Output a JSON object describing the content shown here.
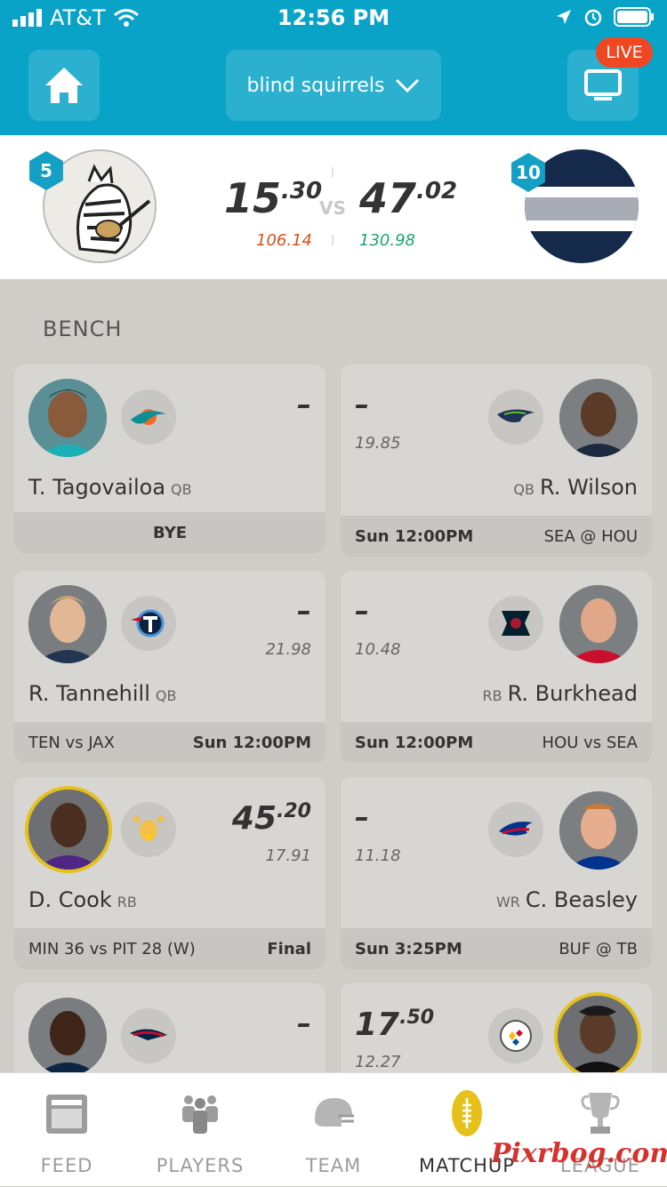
{
  "status": {
    "carrier": "AT&T",
    "time": "12:56 PM"
  },
  "header": {
    "league_name": "blind squirrels",
    "live_label": "LIVE"
  },
  "matchup": {
    "left": {
      "rank": "5",
      "score_whole": "15",
      "score_frac": ".30",
      "projected": "106.14"
    },
    "vs": "VS",
    "right": {
      "rank": "10",
      "score_whole": "47",
      "score_frac": ".02",
      "projected": "130.98"
    }
  },
  "bench": {
    "title": "BENCH",
    "cards": [
      {
        "name": "T. Tagovailoa",
        "pos": "QB",
        "points": "–",
        "proj": "",
        "foot_left": "BYE",
        "foot_right": ""
      },
      {
        "name": "R. Wilson",
        "pos": "QB",
        "points": "–",
        "proj": "19.85",
        "foot_left": "Sun 12:00PM",
        "foot_right": "SEA @ HOU"
      },
      {
        "name": "R. Tannehill",
        "pos": "QB",
        "points": "–",
        "proj": "21.98",
        "foot_left": "TEN vs JAX",
        "foot_right": "Sun 12:00PM"
      },
      {
        "name": "R. Burkhead",
        "pos": "RB",
        "points": "–",
        "proj": "10.48",
        "foot_left": "Sun 12:00PM",
        "foot_right": "HOU vs SEA"
      },
      {
        "name": "D. Cook",
        "pos": "RB",
        "points_whole": "45",
        "points_frac": ".20",
        "proj": "17.91",
        "foot_left": "MIN 36 vs PIT 28 (W)",
        "foot_right": "Final"
      },
      {
        "name": "C. Beasley",
        "pos": "WR",
        "points": "–",
        "proj": "11.18",
        "foot_left": "Sun 3:25PM",
        "foot_right": "BUF @ TB"
      },
      {
        "points": "–"
      },
      {
        "points_whole": "17",
        "points_frac": ".50",
        "proj": "12.27"
      }
    ]
  },
  "tabs": [
    {
      "label": "FEED"
    },
    {
      "label": "PLAYERS"
    },
    {
      "label": "TEAM"
    },
    {
      "label": "MATCHUP"
    },
    {
      "label": "LEAGUE"
    }
  ],
  "watermark": "Pixrbog.com",
  "colors": {
    "header": "#0aa3c8",
    "live": "#ef4722",
    "proj_bad": "#d6501b",
    "proj_good": "#1aa76b",
    "active_tab": "#e5c11a"
  },
  "icons": [
    "home-icon",
    "chevron-down-icon",
    "tv-icon",
    "signal-icon",
    "wifi-icon",
    "location-icon",
    "alarm-icon",
    "battery-icon",
    "feed-icon",
    "players-icon",
    "helmet-icon",
    "football-icon",
    "trophy-icon"
  ]
}
